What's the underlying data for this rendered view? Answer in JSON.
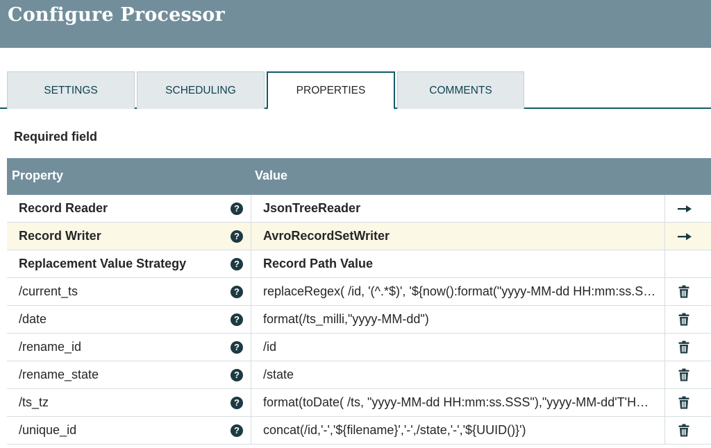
{
  "dialog": {
    "title": "Configure Processor"
  },
  "tabs": [
    {
      "label": "SETTINGS"
    },
    {
      "label": "SCHEDULING"
    },
    {
      "label": "PROPERTIES",
      "active": true
    },
    {
      "label": "COMMENTS"
    }
  ],
  "required_note": "Required field",
  "table": {
    "headers": {
      "property": "Property",
      "value": "Value"
    },
    "rows": [
      {
        "property": "Record Reader",
        "value": "JsonTreeReader",
        "required": true,
        "action": "arrow-right-icon"
      },
      {
        "property": "Record Writer",
        "value": "AvroRecordSetWriter",
        "required": true,
        "action": "arrow-right-icon",
        "highlighted": true
      },
      {
        "property": "Replacement Value Strategy",
        "value": "Record Path Value",
        "required": true,
        "action": ""
      },
      {
        "property": "/current_ts",
        "value": "replaceRegex( /id, '(^.*$)', '${now():format(\"yyyy-MM-dd HH:mm:ss.SSS\")}' )",
        "required": false,
        "action": "trash-icon"
      },
      {
        "property": "/date",
        "value": "format(/ts_milli,\"yyyy-MM-dd\")",
        "required": false,
        "action": "trash-icon"
      },
      {
        "property": "/rename_id",
        "value": "/id",
        "required": false,
        "action": "trash-icon"
      },
      {
        "property": "/rename_state",
        "value": "/state",
        "required": false,
        "action": "trash-icon"
      },
      {
        "property": "/ts_tz",
        "value": "format(toDate( /ts, \"yyyy-MM-dd HH:mm:ss.SSS\"),\"yyyy-MM-dd'T'HH:mm:ss.SSSZ\")",
        "required": false,
        "action": "trash-icon"
      },
      {
        "property": "/unique_id",
        "value": "concat(/id,'-','${filename}','-',/state,'-','${UUID()}')",
        "required": false,
        "action": "trash-icon"
      }
    ]
  },
  "help_icon_glyph": "?",
  "colors": {
    "header_bg": "#728e9b",
    "accent": "#0e5a66",
    "highlight_row": "#fcf8e6"
  }
}
